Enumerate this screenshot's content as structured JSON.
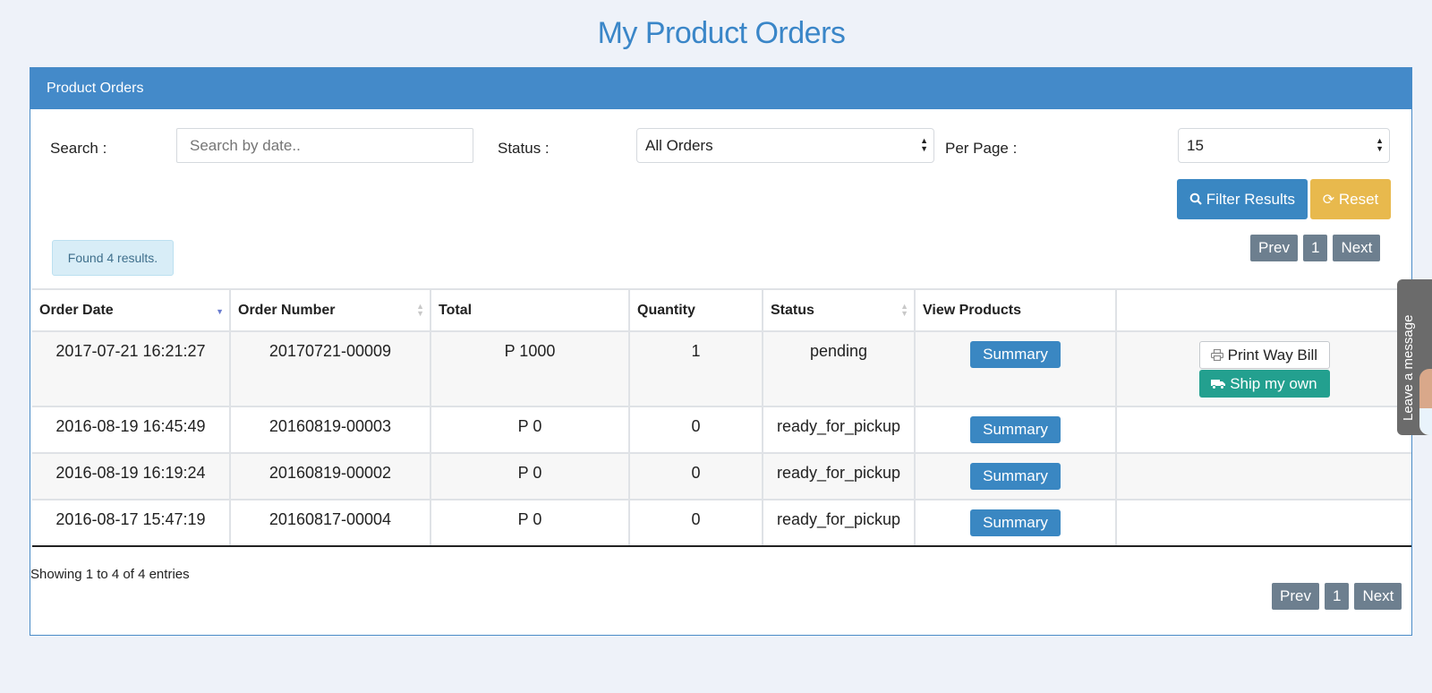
{
  "page": {
    "title": "My Product Orders"
  },
  "panel": {
    "heading": "Product Orders"
  },
  "filters": {
    "search_label": "Search :",
    "search_placeholder": "Search by date..",
    "status_label": "Status :",
    "status_value": "All Orders",
    "per_page_label": "Per Page :",
    "per_page_value": "15",
    "filter_button": "Filter Results",
    "reset_button": "Reset"
  },
  "results": {
    "found_text": "Found 4 results."
  },
  "pagination": {
    "prev": "Prev",
    "page": "1",
    "next": "Next"
  },
  "table": {
    "headers": [
      "Order Date",
      "Order Number",
      "Total",
      "Quantity",
      "Status",
      "View Products",
      ""
    ],
    "rows": [
      {
        "date": "2017-07-21 16:21:27",
        "number": "20170721-00009",
        "total": "P 1000",
        "quantity": "1",
        "status": "pending",
        "view": "Summary",
        "print": "Print Way Bill",
        "ship": "Ship my own"
      },
      {
        "date": "2016-08-19 16:45:49",
        "number": "20160819-00003",
        "total": "P 0",
        "quantity": "0",
        "status": "ready_for_pickup",
        "view": "Summary"
      },
      {
        "date": "2016-08-19 16:19:24",
        "number": "20160819-00002",
        "total": "P 0",
        "quantity": "0",
        "status": "ready_for_pickup",
        "view": "Summary"
      },
      {
        "date": "2016-08-17 15:47:19",
        "number": "20160817-00004",
        "total": "P 0",
        "quantity": "0",
        "status": "ready_for_pickup",
        "view": "Summary"
      }
    ]
  },
  "footer": {
    "showing": "Showing 1 to 4 of 4 entries"
  },
  "chat_widget": {
    "label": "Leave a message"
  },
  "colors": {
    "primary": "#448ac9",
    "warning": "#e8b94d",
    "success": "#23a08f",
    "pager": "#6d7f8f"
  },
  "icons": {
    "filter": "search-icon",
    "reset": "refresh-icon",
    "print": "printer-icon",
    "ship": "truck-icon"
  }
}
